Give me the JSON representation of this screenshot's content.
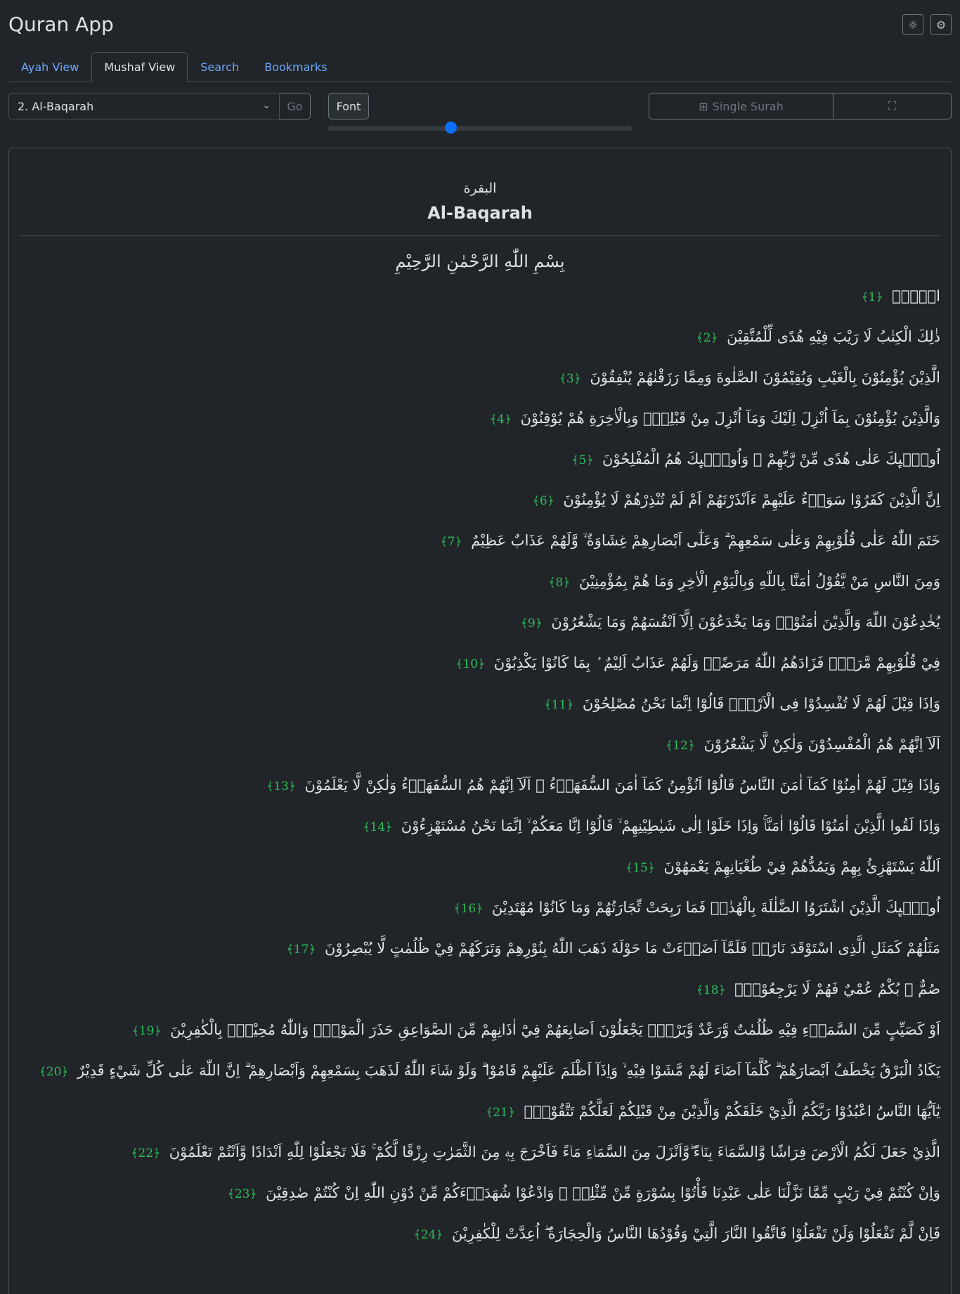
{
  "app": {
    "title": "Quran App"
  },
  "icons": {
    "theme": "sun-icon",
    "settings": "gear-icon"
  },
  "tabs": [
    {
      "label": "Ayah View",
      "active": false
    },
    {
      "label": "Mushaf View",
      "active": true
    },
    {
      "label": "Search",
      "active": false
    },
    {
      "label": "Bookmarks",
      "active": false
    }
  ],
  "controls": {
    "surah_select": "2. Al-Baqarah",
    "go_label": "Go",
    "font_label": "Font",
    "font_size_fraction": 0.4,
    "single_surah_label": "Single Surah"
  },
  "surah": {
    "name_ar": "البقرة",
    "name_en": "Al-Baqarah",
    "bismillah": "بِسْمِ اللّٰهِ الرَّحْمٰنِ الرَّحِيْمِ"
  },
  "ayahs": [
    {
      "text": "الۤمّۤ",
      "num": "﴿1﴾"
    },
    {
      "text": "ذٰلِكَ الْكِتٰبُ لَا رَيْبَ فِيْهِ هُدًى لِّلْمُتَّقِيْنَ",
      "num": "﴿2﴾"
    },
    {
      "text": "الَّذِيْنَ يُؤْمِنُوْنَ بِالْغَيْبِ وَيُقِيْمُوْنَ الصَّلٰوةَ وَمِمَّا رَزَقْنٰهُمْ يُنْفِقُوْنَ",
      "num": "﴿3﴾"
    },
    {
      "text": "وَالَّذِيْنَ يُؤْمِنُوْنَ بِمَآ اُنْزِلَ اِلَيْكَ وَمَآ اُنْزِلَ مِنْ قَبْلِكَۚ وَبِالْاٰخِرَةِ هُمْ يُوْقِنُوْنَ",
      "num": "﴿4﴾"
    },
    {
      "text": "اُولٰۤىِٕكَ عَلٰى هُدًى مِّنْ رَّبِّهِمْ ۙ وَاُولٰۤىِٕكَ هُمُ الْمُفْلِحُوْنَ",
      "num": "﴿5﴾"
    },
    {
      "text": "اِنَّ الَّذِيْنَ كَفَرُوْا سَوَاۤءٌ عَلَيْهِمْ ءَاَنْذَرْتَهُمْ اَمْ لَمْ تُنْذِرْهُمْ لَا يُؤْمِنُوْنَ",
      "num": "﴿6﴾"
    },
    {
      "text": "خَتَمَ اللّٰهُ عَلٰى قُلُوْبِهِمْ وَعَلٰى سَمْعِهِمْ ۗ وَعَلٰٓى اَبْصَارِهِمْ غِشَاوَةٌ ۙ وَّلَهُمْ عَذَابٌ عَظِيْمٌ",
      "num": "﴿7﴾"
    },
    {
      "text": "وَمِنَ النَّاسِ مَنْ يَّقُوْلُ اٰمَنَّا بِاللّٰهِ وَبِالْيَوْمِ الْاٰخِرِ وَمَا هُمْ بِمُؤْمِنِيْنَ",
      "num": "﴿8﴾"
    },
    {
      "text": "يُخٰدِعُوْنَ اللّٰهَ وَالَّذِيْنَ اٰمَنُوْاۚ وَمَا يَخْدَعُوْنَ اِلَّآ اَنْفُسَهُمْ وَمَا يَشْعُرُوْنَ",
      "num": "﴿9﴾"
    },
    {
      "text": "فِيْ قُلُوْبِهِمْ مَّرَضٌۙ فَزَادَهُمُ اللّٰهُ مَرَضًاۚ وَلَهُمْ عَذَابٌ اَلِيْمٌ ۢ بِمَا كَانُوْا يَكْذِبُوْنَ",
      "num": "﴿10﴾"
    },
    {
      "text": "وَاِذَا قِيْلَ لَهُمْ لَا تُفْسِدُوْا فِى الْاَرْضِۙ قَالُوْٓا اِنَّمَا نَحْنُ مُصْلِحُوْنَ",
      "num": "﴿11﴾"
    },
    {
      "text": "اَلَآ اِنَّهُمْ هُمُ الْمُفْسِدُوْنَ وَلٰكِنْ لَّا يَشْعُرُوْنَ",
      "num": "﴿12﴾"
    },
    {
      "text": "وَاِذَا قِيْلَ لَهُمْ اٰمِنُوْا كَمَآ اٰمَنَ النَّاسُ قَالُوْٓا اَنُؤْمِنُ كَمَآ اٰمَنَ السُّفَهَاۤءُ ۗ اَلَآ اِنَّهُمْ هُمُ السُّفَهَاۤءُ وَلٰكِنْ لَّا يَعْلَمُوْنَ",
      "num": "﴿13﴾"
    },
    {
      "text": "وَاِذَا لَقُوا الَّذِيْنَ اٰمَنُوْا قَالُوْٓا اٰمَنَّاۚ وَاِذَا خَلَوْا اِلٰى شَيٰطِيْنِهِمْ ۙ قَالُوْٓا اِنَّا مَعَكُمْ ۙ اِنَّمَا نَحْنُ مُسْتَهْزِءُوْنَ",
      "num": "﴿14﴾"
    },
    {
      "text": "اَللّٰهُ يَسْتَهْزِئُ بِهِمْ وَيَمُدُّهُمْ فِيْ طُغْيَانِهِمْ يَعْمَهُوْنَ",
      "num": "﴿15﴾"
    },
    {
      "text": "اُولٰۤىِٕكَ الَّذِيْنَ اشْتَرَوُا الضَّلٰلَةَ بِالْهُدٰىۖ فَمَا رَبِحَتْ تِّجَارَتُهُمْ وَمَا كَانُوْا مُهْتَدِيْنَ",
      "num": "﴿16﴾"
    },
    {
      "text": "مَثَلُهُمْ كَمَثَلِ الَّذِى اسْتَوْقَدَ نَارًاۚ فَلَمَّآ اَضَاۤءَتْ مَا حَوْلَهٗ ذَهَبَ اللّٰهُ بِنُوْرِهِمْ وَتَرَكَهُمْ فِيْ ظُلُمٰتٍ لَّا يُبْصِرُوْنَ",
      "num": "﴿17﴾"
    },
    {
      "text": "صُمٌّ ۢ بُكْمٌ عُمْيٌ فَهُمْ لَا يَرْجِعُوْنَۙ",
      "num": "﴿18﴾"
    },
    {
      "text": "اَوْ كَصَيِّبٍ مِّنَ السَّمَاۤءِ فِيْهِ ظُلُمٰتٌ وَّرَعْدٌ وَّبَرْقٌۚ يَجْعَلُوْنَ اَصَابِعَهُمْ فِيْٓ اٰذَانِهِمْ مِّنَ الصَّوَاعِقِ حَذَرَ الْمَوْتِۗ وَاللّٰهُ مُحِيْطٌۢ بِالْكٰفِرِيْنَ",
      "num": "﴿19﴾"
    },
    {
      "text": "يَكَادُ الْبَرْقُ يَخْطَفُ اَبْصَارَهُمْ ۗ كُلَّمَآ اَضَاۤءَ لَهُمْ مَّشَوْا فِيْهِ ۙ وَاِذَآ اَظْلَمَ عَلَيْهِمْ قَامُوْا ۗ وَلَوْ شَاۤءَ اللّٰهُ لَذَهَبَ بِسَمْعِهِمْ وَاَبْصَارِهِمْ ۗ اِنَّ اللّٰهَ عَلٰى كُلِّ شَيْءٍ قَدِيْرٌ",
      "num": "﴿20﴾"
    },
    {
      "text": "يٰٓاَيُّهَا النَّاسُ اعْبُدُوْا رَبَّكُمُ الَّذِيْ خَلَقَكُمْ وَالَّذِيْنَ مِنْ قَبْلِكُمْ لَعَلَّكُمْ تَتَّقُوْنَۙ",
      "num": "﴿21﴾"
    },
    {
      "text": "الَّذِيْ جَعَلَ لَكُمُ الْاَرْضَ فِرَاشًا وَّالسَّمَاۤءَ بِنَاۤءً ۖوَّاَنْزَلَ مِنَ السَّمَاۤءِ مَاۤءً فَاَخْرَجَ بِهٖ مِنَ الثَّمَرٰتِ رِزْقًا لَّكُمْ ۚ فَلَا تَجْعَلُوْا لِلّٰهِ اَنْدَادًا وَّاَنْتُمْ تَعْلَمُوْنَ",
      "num": "﴿22﴾"
    },
    {
      "text": "وَاِنْ كُنْتُمْ فِيْ رَيْبٍ مِّمَّا نَزَّلْنَا عَلٰى عَبْدِنَا فَأْتُوْا بِسُوْرَةٍ مِّنْ مِّثْلِهٖ ۖ وَادْعُوْا شُهَدَاۤءَكُمْ مِّنْ دُوْنِ اللّٰهِ اِنْ كُنْتُمْ صٰدِقِيْنَ",
      "num": "﴿23﴾"
    },
    {
      "text": "فَاِنْ لَّمْ تَفْعَلُوْا وَلَنْ تَفْعَلُوْا فَاتَّقُوا النَّارَ الَّتِيْ وَقُوْدُهَا النَّاسُ وَالْحِجَارَةُ ۖ اُعِدَّتْ لِلْكٰفِرِيْنَ",
      "num": "﴿24﴾"
    }
  ]
}
